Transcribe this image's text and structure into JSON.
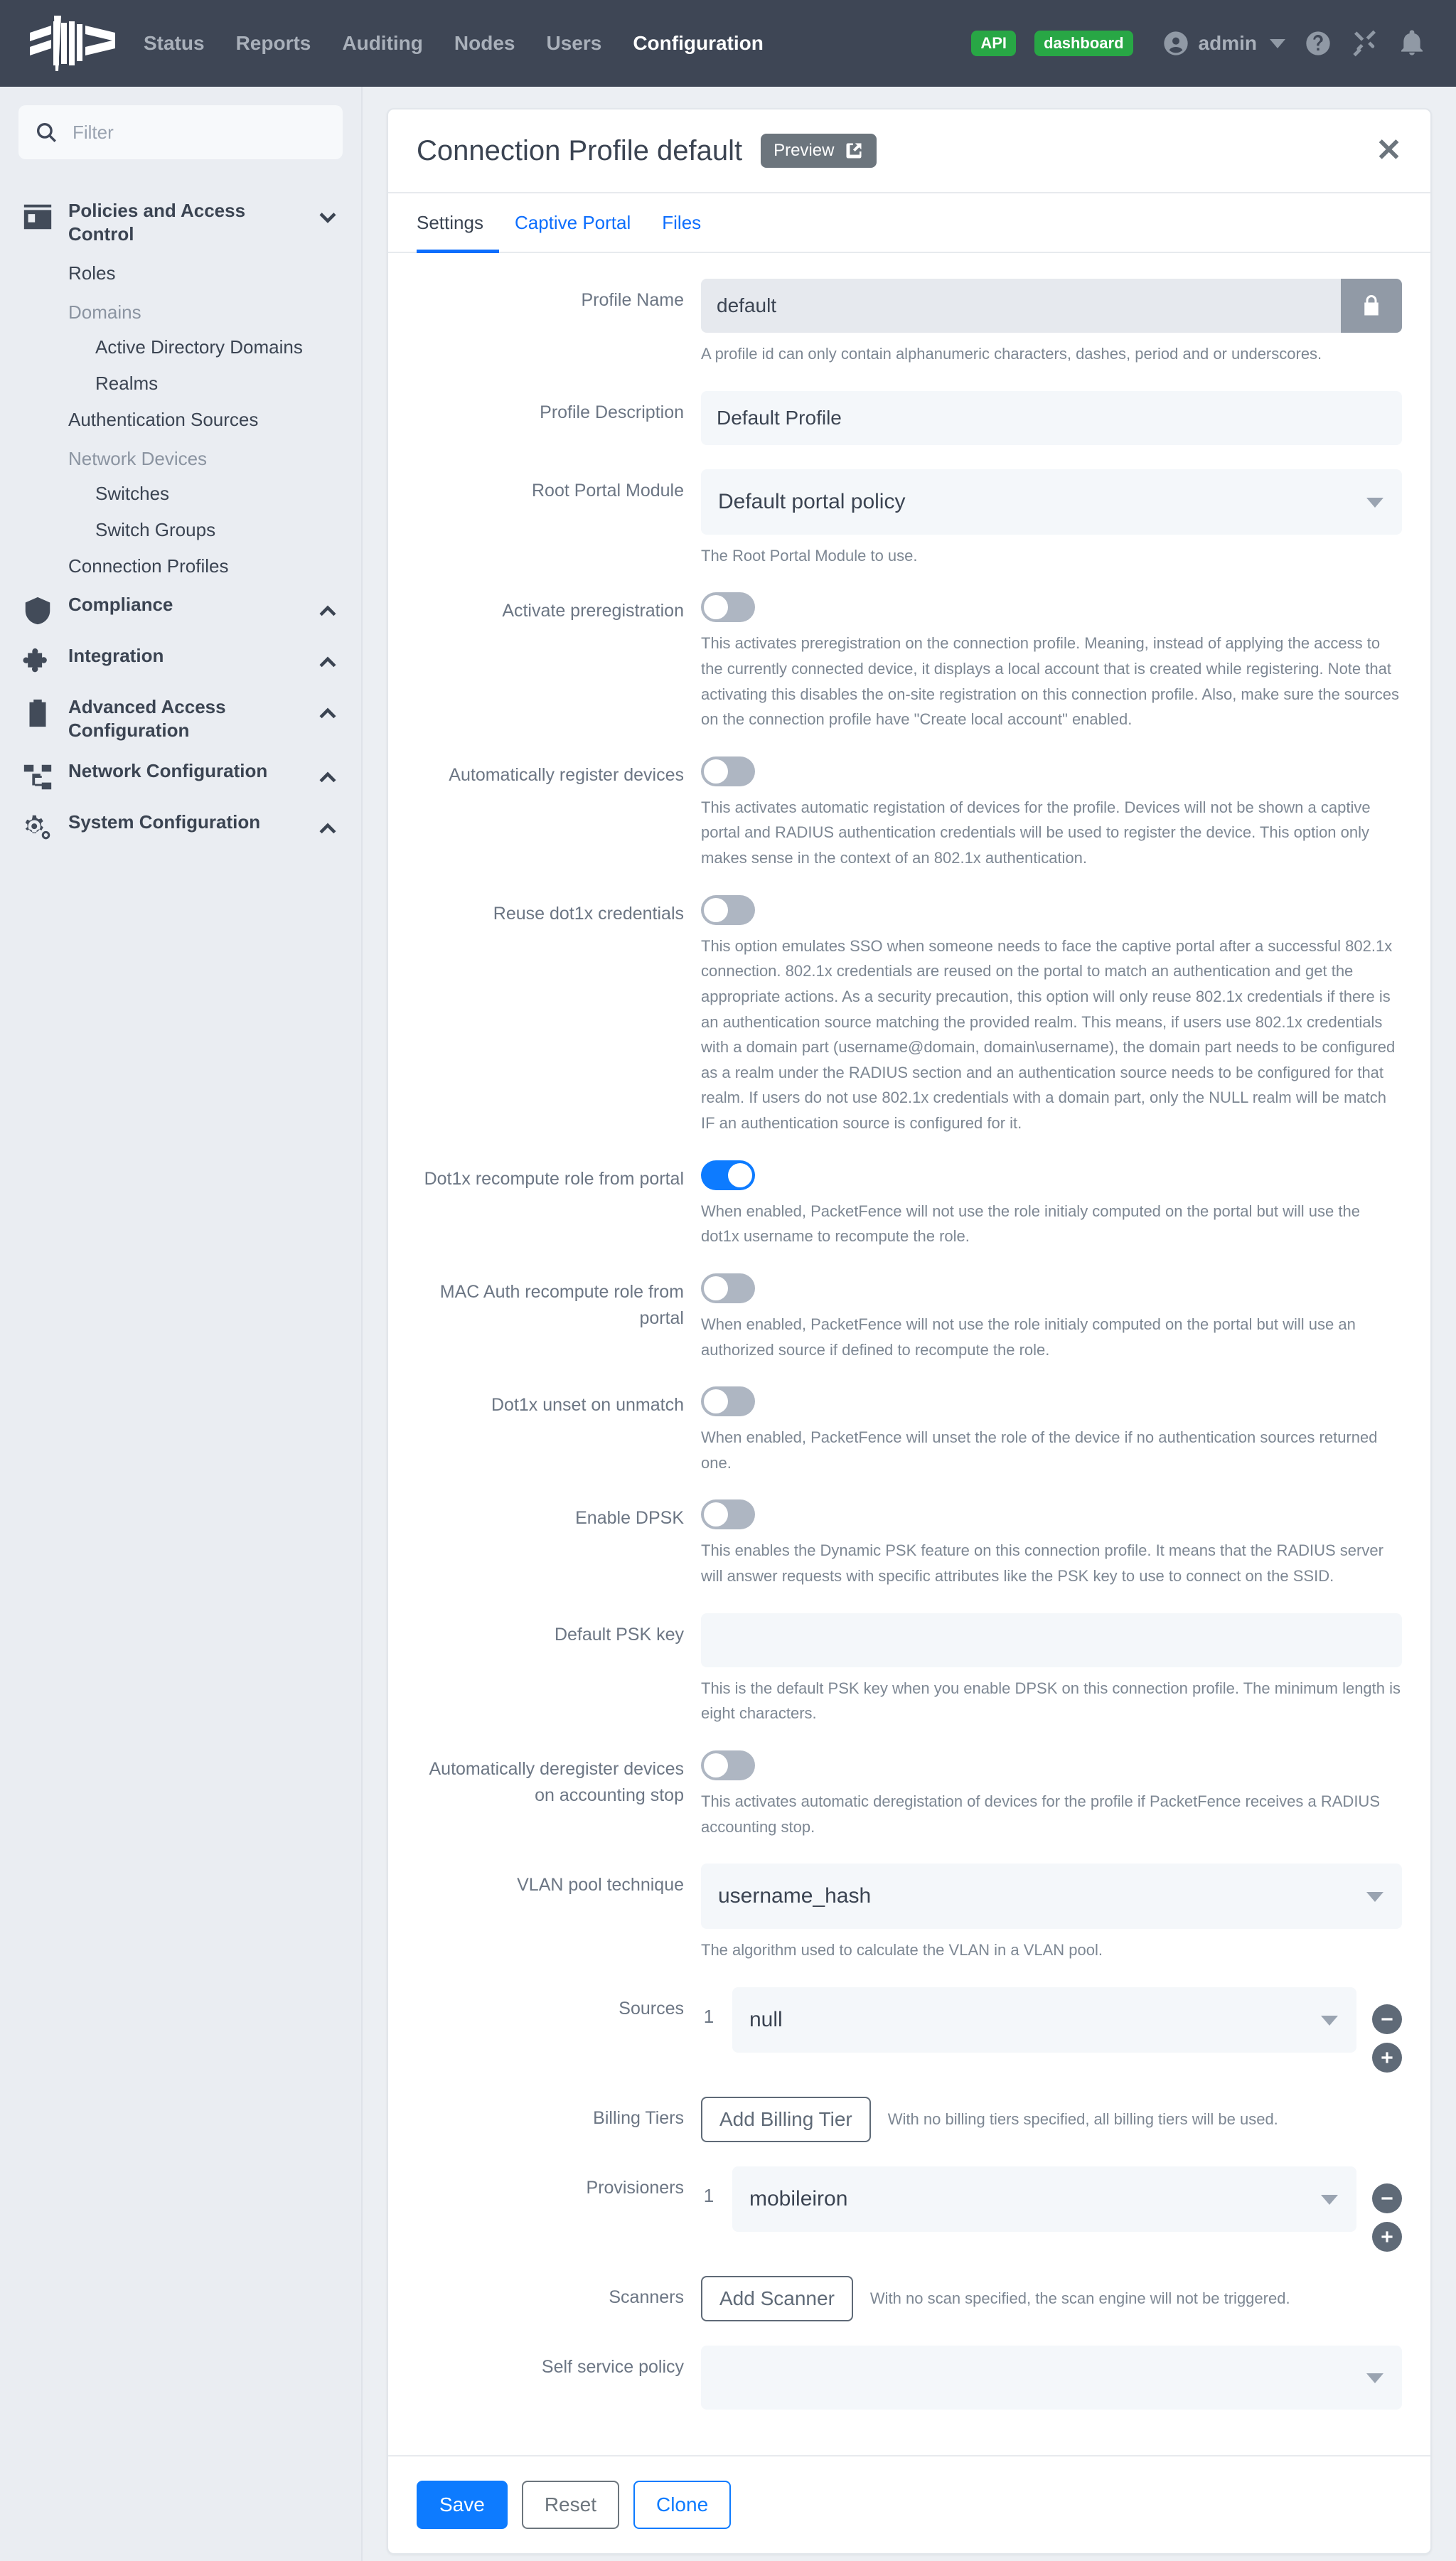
{
  "navbar": {
    "logo_name": "packetfence-logo",
    "links": [
      {
        "label": "Status",
        "active": false
      },
      {
        "label": "Reports",
        "active": false
      },
      {
        "label": "Auditing",
        "active": false
      },
      {
        "label": "Nodes",
        "active": false
      },
      {
        "label": "Users",
        "active": false
      },
      {
        "label": "Configuration",
        "active": true
      }
    ],
    "badges": [
      {
        "label": "API",
        "color": "#28a745"
      },
      {
        "label": "dashboard",
        "color": "#28a745"
      }
    ],
    "user": "admin",
    "icons": [
      "user-circle-icon",
      "chevron-down-icon",
      "help-circle-icon",
      "tools-icon",
      "bell-icon"
    ]
  },
  "sidebar": {
    "filter_placeholder": "Filter",
    "filter_value": "",
    "groups": [
      {
        "label": "Policies and Access Control",
        "icon": "id-card-icon",
        "chevron": "down",
        "items": [
          {
            "label": "Roles",
            "type": "item"
          },
          {
            "label": "Domains",
            "type": "head"
          },
          {
            "label": "Active Directory Domains",
            "type": "sub"
          },
          {
            "label": "Realms",
            "type": "sub"
          },
          {
            "label": "Authentication Sources",
            "type": "item"
          },
          {
            "label": "Network Devices",
            "type": "head"
          },
          {
            "label": "Switches",
            "type": "sub"
          },
          {
            "label": "Switch Groups",
            "type": "sub"
          },
          {
            "label": "Connection Profiles",
            "type": "item"
          }
        ]
      },
      {
        "label": "Compliance",
        "icon": "shield-icon",
        "chevron": "up",
        "items": []
      },
      {
        "label": "Integration",
        "icon": "puzzle-icon",
        "chevron": "up",
        "items": []
      },
      {
        "label": "Advanced Access Configuration",
        "icon": "clipboard-icon",
        "chevron": "up",
        "items": []
      },
      {
        "label": "Network Configuration",
        "icon": "network-icon",
        "chevron": "up",
        "items": []
      },
      {
        "label": "System Configuration",
        "icon": "gears-icon",
        "chevron": "up",
        "items": []
      }
    ]
  },
  "card": {
    "title": "Connection Profile default",
    "preview_label": "Preview",
    "close_icon": "✕",
    "tabs": [
      {
        "label": "Settings",
        "active": true
      },
      {
        "label": "Captive Portal",
        "active": false
      },
      {
        "label": "Files",
        "active": false
      }
    ]
  },
  "form": {
    "profile_name": {
      "label": "Profile Name",
      "value": "default",
      "locked": true,
      "hint": "A profile id can only contain alphanumeric characters, dashes, period and or underscores."
    },
    "profile_description": {
      "label": "Profile Description",
      "value": "Default Profile"
    },
    "root_portal_module": {
      "label": "Root Portal Module",
      "value": "Default portal policy",
      "hint": "The Root Portal Module to use."
    },
    "activate_preregistration": {
      "label": "Activate preregistration",
      "enabled": false,
      "hint": "This activates preregistration on the connection profile. Meaning, instead of applying the access to the currently connected device, it displays a local account that is created while registering. Note that activating this disables the on-site registration on this connection profile. Also, make sure the sources on the connection profile have \"Create local account\" enabled."
    },
    "auto_register_devices": {
      "label": "Automatically register devices",
      "enabled": false,
      "hint": "This activates automatic registation of devices for the profile. Devices will not be shown a captive portal and RADIUS authentication credentials will be used to register the device. This option only makes sense in the context of an 802.1x authentication."
    },
    "reuse_dot1x_credentials": {
      "label": "Reuse dot1x credentials",
      "enabled": false,
      "hint": "This option emulates SSO when someone needs to face the captive portal after a successful 802.1x connection. 802.1x credentials are reused on the portal to match an authentication and get the appropriate actions. As a security precaution, this option will only reuse 802.1x credentials if there is an authentication source matching the provided realm. This means, if users use 802.1x credentials with a domain part (username@domain, domain\\username), the domain part needs to be configured as a realm under the RADIUS section and an authentication source needs to be configured for that realm. If users do not use 802.1x credentials with a domain part, only the NULL realm will be match IF an authentication source is configured for it."
    },
    "dot1x_recompute_role": {
      "label": "Dot1x recompute role from portal",
      "enabled": true,
      "hint": "When enabled, PacketFence will not use the role initialy computed on the portal but will use the dot1x username to recompute the role."
    },
    "mac_auth_recompute_role": {
      "label": "MAC Auth recompute role from portal",
      "enabled": false,
      "hint": "When enabled, PacketFence will not use the role initialy computed on the portal but will use an authorized source if defined to recompute the role."
    },
    "dot1x_unset_on_unmatch": {
      "label": "Dot1x unset on unmatch",
      "enabled": false,
      "hint": "When enabled, PacketFence will unset the role of the device if no authentication sources returned one."
    },
    "enable_dpsk": {
      "label": "Enable DPSK",
      "enabled": false,
      "hint": "This enables the Dynamic PSK feature on this connection profile. It means that the RADIUS server will answer requests with specific attributes like the PSK key to use to connect on the SSID."
    },
    "default_psk_key": {
      "label": "Default PSK key",
      "value": "",
      "hint": "This is the default PSK key when you enable DPSK on this connection profile. The minimum length is eight characters."
    },
    "auto_deregister": {
      "label": "Automatically deregister devices on accounting stop",
      "enabled": false,
      "hint": "This activates automatic deregistation of devices for the profile if PacketFence receives a RADIUS accounting stop."
    },
    "vlan_pool_technique": {
      "label": "VLAN pool technique",
      "value": "username_hash",
      "hint": "The algorithm used to calculate the VLAN in a VLAN pool."
    },
    "sources": {
      "label": "Sources",
      "rows": [
        {
          "index": "1",
          "value": "null"
        }
      ]
    },
    "billing_tiers": {
      "label": "Billing Tiers",
      "add_label": "Add Billing Tier",
      "hint": "With no billing tiers specified, all billing tiers will be used."
    },
    "provisioners": {
      "label": "Provisioners",
      "rows": [
        {
          "index": "1",
          "value": "mobileiron"
        }
      ]
    },
    "scanners": {
      "label": "Scanners",
      "add_label": "Add Scanner",
      "hint": "With no scan specified, the scan engine will not be triggered."
    },
    "self_service_policy": {
      "label": "Self service policy",
      "value": ""
    }
  },
  "footer": {
    "save": "Save",
    "reset": "Reset",
    "clone": "Clone"
  }
}
